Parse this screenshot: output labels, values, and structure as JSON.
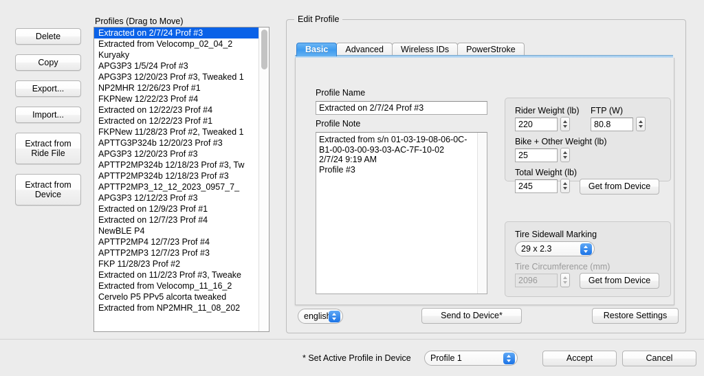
{
  "left_buttons": [
    {
      "label": "Delete",
      "tall": false
    },
    {
      "label": "Copy",
      "tall": false
    },
    {
      "label": "Export...",
      "tall": false
    },
    {
      "label": "Import...",
      "tall": false
    },
    {
      "label": "Extract from\nRide File",
      "tall": true
    },
    {
      "label": "Extract from\nDevice",
      "tall": true
    }
  ],
  "profiles_panel": {
    "title": "Profiles (Drag to Move)",
    "selected_index": 0,
    "items": [
      "Extracted on 2/7/24 Prof #3",
      "Extracted from Velocomp_02_04_2",
      "Kuryaky",
      "APG3P3 1/5/24 Prof #3",
      "APG3P3 12/20/23 Prof #3, Tweaked 1",
      "NP2MHR 12/26/23 Prof #1",
      "FKPNew 12/22/23 Prof #4",
      "Extracted on 12/22/23 Prof #4",
      "Extracted on 12/22/23 Prof #1",
      "FKPNew 11/28/23 Prof #2, Tweaked 1",
      "APTTG3P324b 12/20/23 Prof #3",
      "APG3P3 12/20/23 Prof #3",
      "APTTP2MP324b 12/18/23 Prof #3, Tw",
      "APTTP2MP324b 12/18/23 Prof #3",
      " APTTP2MP3_12_12_2023_0957_7_",
      "APG3P3 12/12/23 Prof #3",
      "Extracted on 12/9/23 Prof #1",
      "Extracted on 12/7/23 Prof #4",
      "NewBLE P4",
      "APTTP2MP4 12/7/23 Prof #4",
      "APTTP2MP3 12/7/23 Prof #3",
      "FKP 11/28/23 Prof #2",
      "Extracted on 11/2/23 Prof #3, Tweake",
      "Extracted from Velocomp_11_16_2",
      "Cervelo P5 PPv5 alcorta tweaked",
      "Extracted from NP2MHR_11_08_202"
    ]
  },
  "edit_profile": {
    "title": "Edit Profile",
    "tabs": [
      {
        "label": "Basic",
        "active": true
      },
      {
        "label": "Advanced",
        "active": false
      },
      {
        "label": "Wireless IDs",
        "active": false
      },
      {
        "label": "PowerStroke",
        "active": false
      }
    ],
    "profile_name_label": "Profile Name",
    "profile_name_value": "Extracted on 2/7/24 Prof #3",
    "profile_note_label": "Profile Note",
    "profile_note_value": "Extracted from s/n 01-03-19-08-06-0C-B1-00-03-00-93-03-AC-7F-10-02\n2/7/24 9:19 AM\nProfile #3",
    "weights": {
      "rider_weight_label": "Rider Weight (lb)",
      "rider_weight_value": "220",
      "ftp_label": "FTP (W)",
      "ftp_value": "80.8",
      "bike_weight_label": "Bike + Other Weight (lb)",
      "bike_weight_value": "25",
      "total_weight_label": "Total Weight (lb)",
      "total_weight_value": "245",
      "get_from_device_label": "Get from Device"
    },
    "tire": {
      "sidewall_label": "Tire Sidewall Marking",
      "sidewall_value": "29 x 2.3",
      "circumference_label": "Tire Circumference (mm)",
      "circumference_value": "2096",
      "get_from_device_label": "Get from Device"
    },
    "language_value": "english",
    "send_to_device_label": "Send to Device*",
    "restore_settings_label": "Restore Settings"
  },
  "footer": {
    "active_profile_label": "* Set Active Profile in Device",
    "active_profile_value": "Profile 1",
    "accept_label": "Accept",
    "cancel_label": "Cancel"
  },
  "colors": {
    "selection_blue": "#0a62e8",
    "accent_blue": "#1b73e6",
    "window_bg": "#ececec"
  }
}
